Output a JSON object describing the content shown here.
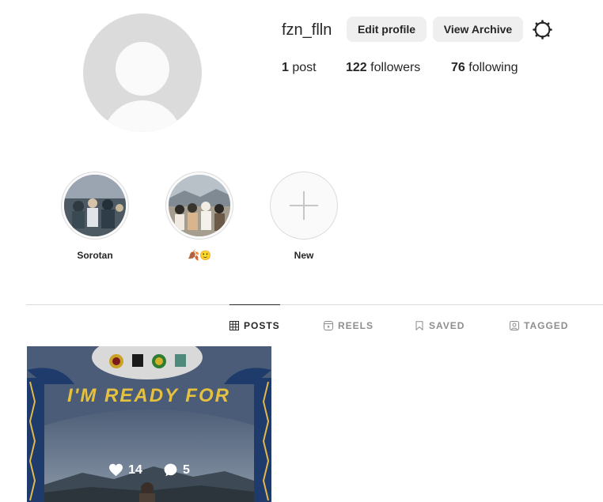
{
  "profile": {
    "username": "fzn_flln",
    "edit_profile_label": "Edit profile",
    "view_archive_label": "View Archive",
    "stats": {
      "posts_count": "1",
      "posts_label": "post",
      "followers_count": "122",
      "followers_label": "followers",
      "following_count": "76",
      "following_label": "following"
    }
  },
  "highlights": [
    {
      "label": "Sorotan"
    },
    {
      "label": "🍂🙂"
    },
    {
      "label": "New"
    }
  ],
  "tabs": [
    {
      "label": "POSTS",
      "icon": "grid-icon",
      "active": true
    },
    {
      "label": "REELS",
      "icon": "reels-icon",
      "active": false
    },
    {
      "label": "SAVED",
      "icon": "bookmark-icon",
      "active": false
    },
    {
      "label": "TAGGED",
      "icon": "tag-person-icon",
      "active": false
    }
  ],
  "posts": [
    {
      "likes": "14",
      "comments": "5",
      "poster_text": "I'M READY FOR"
    }
  ]
}
